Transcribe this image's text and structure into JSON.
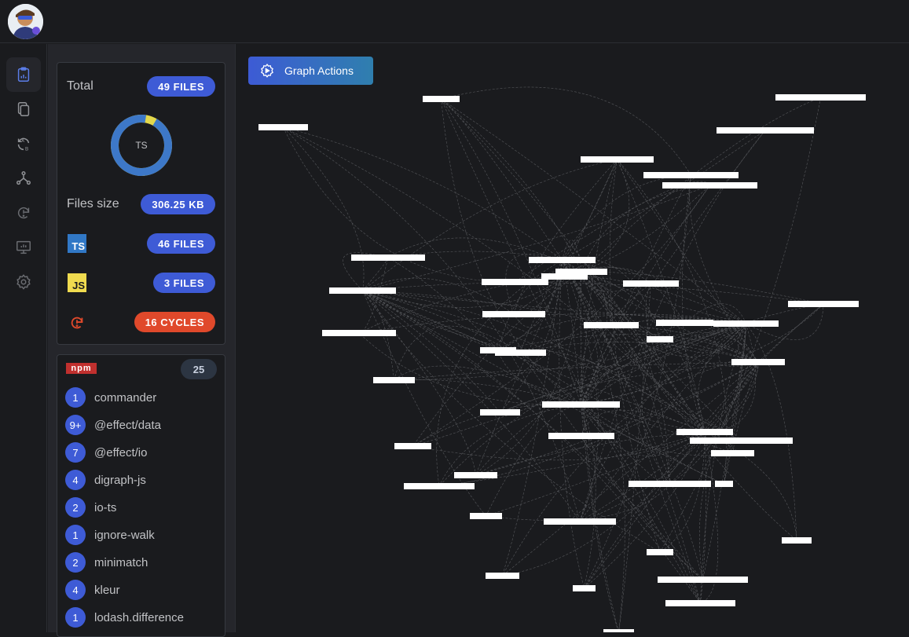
{
  "app": {
    "avatar_icon": "user-avatar-icon"
  },
  "rail": {
    "items": [
      {
        "icon": "clipboard-icon",
        "active": true
      },
      {
        "icon": "files-icon",
        "active": false
      },
      {
        "icon": "refresh-ab-icon",
        "active": false
      },
      {
        "icon": "graph-nodes-icon",
        "active": false
      },
      {
        "icon": "cycle-alert-icon",
        "active": false
      },
      {
        "icon": "presentation-icon",
        "active": false
      },
      {
        "icon": "gear-icon",
        "active": false
      }
    ]
  },
  "summary": {
    "total_label": "Total",
    "total_badge": "49 FILES",
    "donut_label": "TS",
    "donut_ts_fraction": 0.94,
    "donut_colors": {
      "ts": "#3d78c8",
      "js": "#e3d84c"
    },
    "size_label": "Files size",
    "size_badge": "306.25 KB",
    "ts_icon_text": "TS",
    "ts_badge": "46 FILES",
    "js_icon_text": "JS",
    "js_badge": "3 FILES",
    "cycles_badge": "16 CYCLES"
  },
  "npm": {
    "logo_text": "npm",
    "count": "25",
    "deps": [
      {
        "count": "1",
        "name": "commander"
      },
      {
        "count": "9+",
        "name": "@effect/data"
      },
      {
        "count": "7",
        "name": "@effect/io"
      },
      {
        "count": "4",
        "name": "digraph-js"
      },
      {
        "count": "2",
        "name": "io-ts"
      },
      {
        "count": "1",
        "name": "ignore-walk"
      },
      {
        "count": "2",
        "name": "minimatch"
      },
      {
        "count": "4",
        "name": "kleur"
      },
      {
        "count": "1",
        "name": "lodash.difference"
      }
    ]
  },
  "graph": {
    "actions_label": "Graph Actions"
  },
  "colors": {
    "accent": "#3e5bd6",
    "danger": "#e0492b",
    "ts_brand": "#3178c6",
    "js_brand": "#f0db4f",
    "npm_brand": "#c0302e"
  }
}
